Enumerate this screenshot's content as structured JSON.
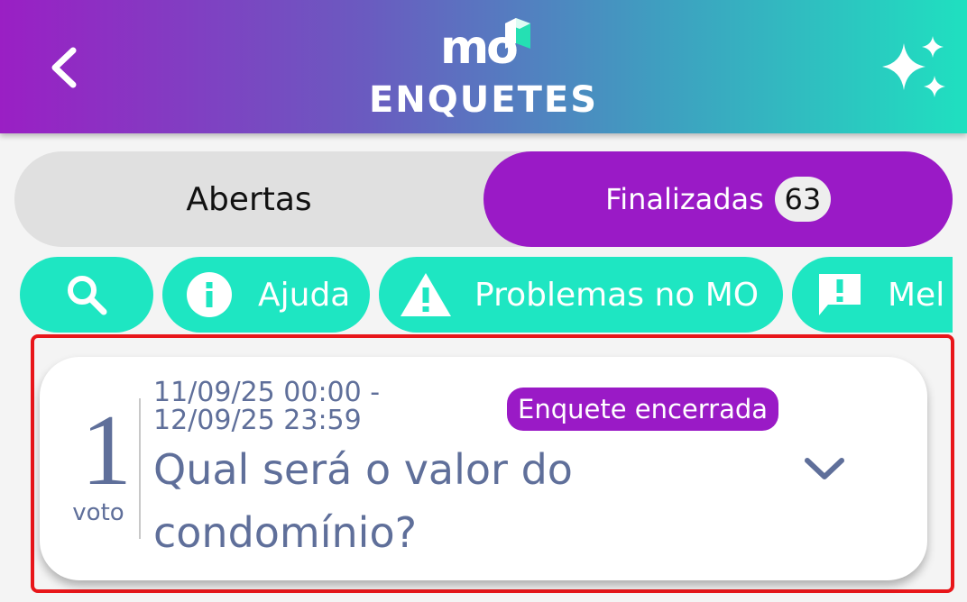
{
  "header": {
    "title": "ENQUETES",
    "logo_text": "mo",
    "back_icon": "chevron-left-icon",
    "ai_icon": "sparkles-icon"
  },
  "tabs": [
    {
      "label": "Abertas",
      "active": false
    },
    {
      "label": "Finalizadas",
      "active": true,
      "count": "63"
    }
  ],
  "chips": [
    {
      "icon": "search-icon",
      "label": ""
    },
    {
      "icon": "info-icon",
      "label": "Ajuda"
    },
    {
      "icon": "warning-icon",
      "label": "Problemas no MO"
    },
    {
      "icon": "feedback-icon",
      "label": "Mel"
    }
  ],
  "poll": {
    "votes": "1",
    "votes_label": "voto",
    "date_start": "11/09/25 00:00 -",
    "date_end": "12/09/25 23:59",
    "status": "Enquete encerrada",
    "question": "Qual será o valor do condomínio?",
    "expand_icon": "chevron-down-icon"
  },
  "colors": {
    "header_gradient_start": "#9a1fc4",
    "header_gradient_end": "#1fe0c0",
    "active_tab": "#9a1ac6",
    "chip": "#1ee6c2",
    "card_text": "#5f6f9a",
    "highlight": "#e8161a"
  }
}
